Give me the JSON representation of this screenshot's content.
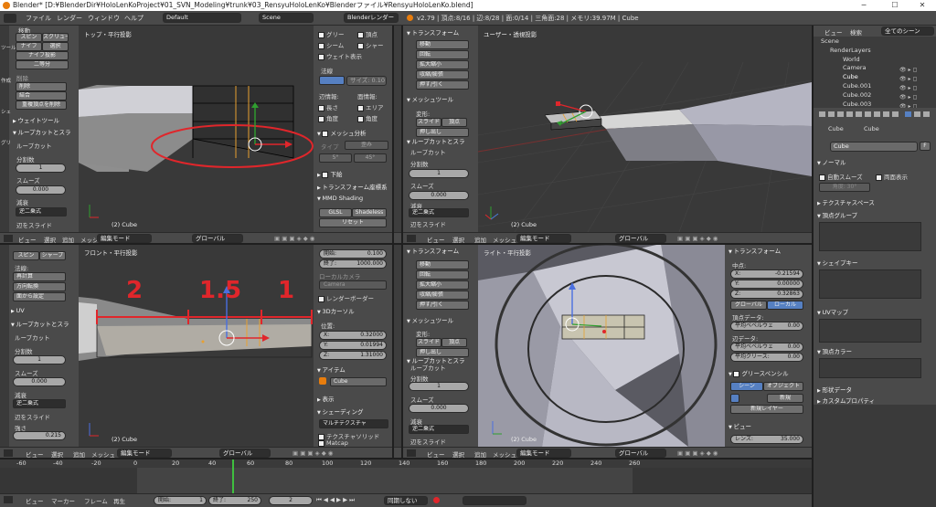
{
  "title": "Blender* [D:¥BlenderDir¥HoloLenKoProject¥01_SVN_Modeling¥trunk¥03_RensyuHoloLenKo¥Blenderファイル¥RensyuHoloLenKo.blend]",
  "window_controls": [
    "─",
    "☐",
    "✕"
  ],
  "menu": {
    "file": "ファイル",
    "render": "レンダー",
    "window": "ウィンドウ",
    "help": "ヘルプ",
    "layout": "Default",
    "scene": "Scene",
    "engine": "Blenderレンダー",
    "stats": "v2.79 | 頂点:8/16 | 辺:8/28 | 面:0/14 | 三角面:28 | メモリ:39.97M | Cube"
  },
  "left_tools_top": {
    "item0": "移動",
    "spin": "スピン",
    "screw": "スクリュー",
    "knife": "ナイフ",
    "select": "選択",
    "knife_proj": "ナイフ投影",
    "bisect": "二等分",
    "remove_label": "削除",
    "delete": "削除",
    "merge": "結合",
    "remove_doubles": "重複頂点を削除",
    "weight_tools": "ウェイトツール",
    "loopcut_section": "ループカットとスラ",
    "loopcut": "ループカット",
    "cuts_label": "分割数",
    "cuts": "1",
    "smooth_label": "スムーズ",
    "smooth": "0.000",
    "falloff_label": "減衰",
    "falloff": "逆二乗式",
    "edge_slide": "辺をスライド",
    "tab_a": "ツール",
    "tab_b": "作成",
    "tab_c": "シェ",
    "tab_d": "グリ"
  },
  "vp_top_left": {
    "label": "トップ・平行投影",
    "object": "(2) Cube"
  },
  "n_panel_top": {
    "glow": "グリー",
    "vertex": "頂点",
    "edge": "辺",
    "seam": "シーム",
    "sharp": "シャー",
    "weight": "ウェイト表示",
    "normal": "法線",
    "size": "サイズ: 0.10",
    "edge_info": "辺情報:",
    "face_info": "面情報:",
    "length": "長さ",
    "area": "エリア",
    "angle": "角度",
    "angle2": "角度",
    "mesh_analysis": "メッシュ分析",
    "type_label": "タイプ",
    "type": "歪み",
    "min": "5°",
    "max": "45°",
    "lower": "下絵",
    "transform_orient": "トランスフォーム座標系",
    "mmd": "MMD Shading",
    "glsl": "GLSL",
    "shadeless": "Shadeless",
    "reset": "リセット"
  },
  "tool_top_right": {
    "transform": "トランスフォーム",
    "move": "移動",
    "rotate": "回転",
    "scale": "拡大縮小",
    "shrink": "収縮/膨張",
    "push": "押す/引く",
    "mesh_tools": "メッシュツール",
    "deform": "変形:",
    "slide": "スライド",
    "vertex": "頂点",
    "extrude": "押し出し",
    "loopcut_section": "ループカットとスラ",
    "loopcut": "ループカット",
    "cuts_label": "分割数",
    "cuts": "1",
    "smooth_label": "スムーズ",
    "smooth": "0.000",
    "falloff_label": "減衰",
    "falloff": "逆二乗式",
    "edge_slide": "辺をスライド"
  },
  "vp_top_right": {
    "label": "ユーザー・透視投影",
    "object": "(2) Cube"
  },
  "outliner": {
    "view": "ビュー",
    "search": "検索",
    "all_scenes": "全てのシーン",
    "items": [
      "Scene",
      "RenderLayers",
      "World",
      "Camera",
      "Cube",
      "Cube.001",
      "Cube.002",
      "Cube.003"
    ]
  },
  "props": {
    "obj1": "Cube",
    "obj2": "Cube",
    "name": "Cube",
    "f": "F",
    "normals": "ノーマル",
    "auto_smooth": "自動スムーズ",
    "double_sided": "両面表示",
    "angle_label": "角度:",
    "angle": "30°",
    "texture_space": "テクスチャスペース",
    "vertex_groups": "頂点グループ",
    "shape_keys": "シェイプキー",
    "uv_maps": "UVマップ",
    "vertex_colors": "頂点カラー",
    "geometry": "形状データ",
    "custom_props": "カスタムプロパティ"
  },
  "header_top": {
    "view": "ビュー",
    "select": "選択",
    "add": "追加",
    "mesh": "メッシュ",
    "mode": "編集モード",
    "orient": "グローバル"
  },
  "left_tools_bottom": {
    "item0": "スピン",
    "sharp": "シャープ",
    "normal": "法線:",
    "recalc": "再計算",
    "flip": "方向転換",
    "from_face": "面から設定",
    "uv": "UV",
    "loopcut_section": "ループカットとスラ",
    "loopcut": "ループカット",
    "cuts_label": "分割数",
    "cuts": "1",
    "smooth_label": "スムーズ",
    "smooth": "0.000",
    "falloff_label": "減衰",
    "falloff": "逆二乗式",
    "edge_slide": "辺をスライド",
    "strength_label": "強さ",
    "strength": "0.215"
  },
  "vp_bottom_left": {
    "label": "フロント・平行投影",
    "object": "(2) Cube",
    "anno_2": "2",
    "anno_15": "1.5",
    "anno_1": "1"
  },
  "n_panel_bottom": {
    "start": "開始:",
    "start_val": "0.100",
    "end": "終了:",
    "end_val": "1000.000",
    "local_camera": "ローカルカメラ",
    "camera": "Camera",
    "render_border": "レンダーボーダー",
    "cursor": "3Dカーソル",
    "position": "位置:",
    "x": "X:",
    "x_val": "0.32000",
    "y": "Y:",
    "y_val": "0.01994",
    "z": "Z:",
    "z_val": "1.31000",
    "item": "アイテム",
    "item_name": "Cube",
    "display": "表示",
    "shading": "シェーディング",
    "multi_tex": "マルチテクスチャ",
    "tex_solid": "テクスチャソリッド",
    "matcap": "Matcap"
  },
  "tool_bottom_right": {
    "transform": "トランスフォーム",
    "move": "移動",
    "rotate": "回転",
    "scale": "拡大縮小",
    "shrink": "収縮/膨張",
    "push": "押す/引く",
    "mesh_tools": "メッシュツール",
    "deform": "変形:",
    "slide": "スライド",
    "vertex": "頂点",
    "extrude": "押し出し",
    "loopcut_section": "ループカットとスラ",
    "loopcut": "ループカット",
    "cuts_label": "分割数",
    "cuts": "1",
    "smooth_label": "スムーズ",
    "smooth": "0.000",
    "falloff_label": "減衰",
    "falloff": "逆二乗式",
    "edge_slide": "辺をスライド"
  },
  "vp_bottom_right": {
    "label": "ライト・平行投影",
    "object": "(2) Cube"
  },
  "n_panel_right": {
    "transform": "トランスフォーム",
    "median": "中点:",
    "x": "X:",
    "x_val": "-0.21594",
    "y": "Y:",
    "y_val": "0.00000",
    "z": "Z:",
    "z_val": "0.32863",
    "global": "グローバル",
    "local": "ローカル",
    "vertex_data": "頂点データ:",
    "mean_bevel": "平均ベベルウェ",
    "mean_bevel_val": "0.00",
    "edge_data": "辺データ:",
    "mean_bevel2": "平均ベベルウェ",
    "mean_bevel2_val": "0.00",
    "mean_crease": "平均クリース:",
    "mean_crease_val": "0.00",
    "grease": "グリースペンシル",
    "scene": "シーン",
    "object": "オブジェクト",
    "new": "新規",
    "new_layer": "新規レイヤー",
    "view": "ビュー",
    "lens": "レンズ:",
    "lens_val": "35.000"
  },
  "header_bottom": {
    "view": "ビュー",
    "select": "選択",
    "add": "追加",
    "mesh": "メッシュ",
    "mode": "編集モード",
    "orient": "グローバル"
  },
  "timeline": {
    "ticks": [
      "-60",
      "-40",
      "-20",
      "0",
      "20",
      "40",
      "60",
      "80",
      "100",
      "120",
      "140",
      "160",
      "180",
      "200",
      "220",
      "240",
      "260"
    ],
    "view": "ビュー",
    "marker": "マーカー",
    "frame": "フレーム",
    "play": "再生",
    "start_label": "開始:",
    "start": "1",
    "end_label": "終了:",
    "end": "250",
    "current": "2",
    "sync": "同期しない"
  },
  "colors": {
    "bg": "#393939",
    "panel": "#4a4a4a",
    "red": "#e0262b",
    "orange": "#e87d0d",
    "select_blue": "#5680c2"
  }
}
